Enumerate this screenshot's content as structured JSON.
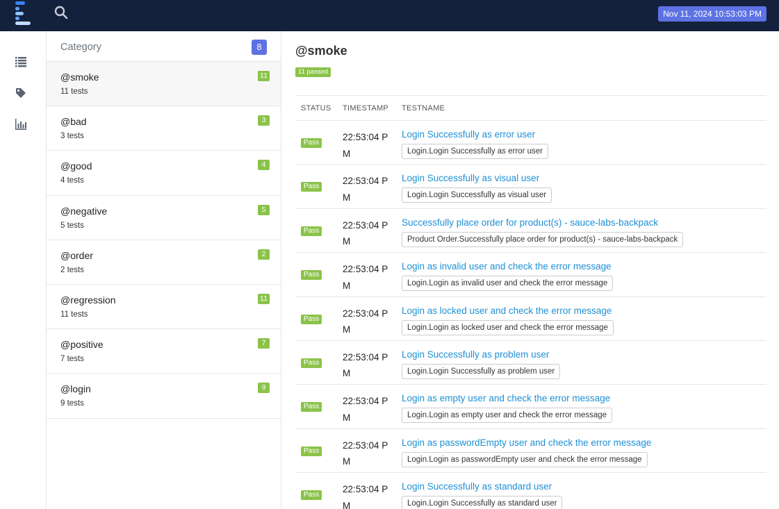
{
  "header": {
    "search_icon": "search-icon",
    "logo_icon": "extent-logo",
    "datetime": "Nov 11, 2024 10:53:03 PM",
    "colors": {
      "navbar": "#14213d",
      "accent": "#5e72e4",
      "pass": "#8bc34a",
      "link": "#1e90d6"
    }
  },
  "rail": {
    "icons": [
      "list-icon",
      "tag-icon",
      "bar-chart-icon"
    ]
  },
  "category": {
    "title": "Category",
    "count": "8",
    "items": [
      {
        "name": "@smoke",
        "sub": "11 tests",
        "badge": "11"
      },
      {
        "name": "@bad",
        "sub": "3 tests",
        "badge": "3"
      },
      {
        "name": "@good",
        "sub": "4 tests",
        "badge": "4"
      },
      {
        "name": "@negative",
        "sub": "5 tests",
        "badge": "5"
      },
      {
        "name": "@order",
        "sub": "2 tests",
        "badge": "2"
      },
      {
        "name": "@regression",
        "sub": "11 tests",
        "badge": "11"
      },
      {
        "name": "@positive",
        "sub": "7 tests",
        "badge": "7"
      },
      {
        "name": "@login",
        "sub": "9 tests",
        "badge": "9"
      }
    ]
  },
  "main": {
    "title": "@smoke",
    "passed_label": "11 passed",
    "columns": {
      "status": "STATUS",
      "timestamp": "TIMESTAMP",
      "testname": "TESTNAME"
    },
    "rows": [
      {
        "status": "Pass",
        "time": "22:53:04 PM",
        "name": "Login Successfully as error user",
        "tag": "Login.Login Successfully as error user"
      },
      {
        "status": "Pass",
        "time": "22:53:04 PM",
        "name": "Login Successfully as visual user",
        "tag": "Login.Login Successfully as visual user"
      },
      {
        "status": "Pass",
        "time": "22:53:04 PM",
        "name": "Successfully place order for product(s) - sauce-labs-backpack",
        "tag": "Product Order.Successfully place order for product(s) - sauce-labs-backpack"
      },
      {
        "status": "Pass",
        "time": "22:53:04 PM",
        "name": "Login as invalid user and check the error message",
        "tag": "Login.Login as invalid user and check the error message"
      },
      {
        "status": "Pass",
        "time": "22:53:04 PM",
        "name": "Login as locked user and check the error message",
        "tag": "Login.Login as locked user and check the error message"
      },
      {
        "status": "Pass",
        "time": "22:53:04 PM",
        "name": "Login Successfully as problem user",
        "tag": "Login.Login Successfully as problem user"
      },
      {
        "status": "Pass",
        "time": "22:53:04 PM",
        "name": "Login as empty user and check the error message",
        "tag": "Login.Login as empty user and check the error message"
      },
      {
        "status": "Pass",
        "time": "22:53:04 PM",
        "name": "Login as passwordEmpty user and check the error message",
        "tag": "Login.Login as passwordEmpty user and check the error message"
      },
      {
        "status": "Pass",
        "time": "22:53:04 PM",
        "name": "Login Successfully as standard user",
        "tag": "Login.Login Successfully as standard user"
      }
    ]
  }
}
